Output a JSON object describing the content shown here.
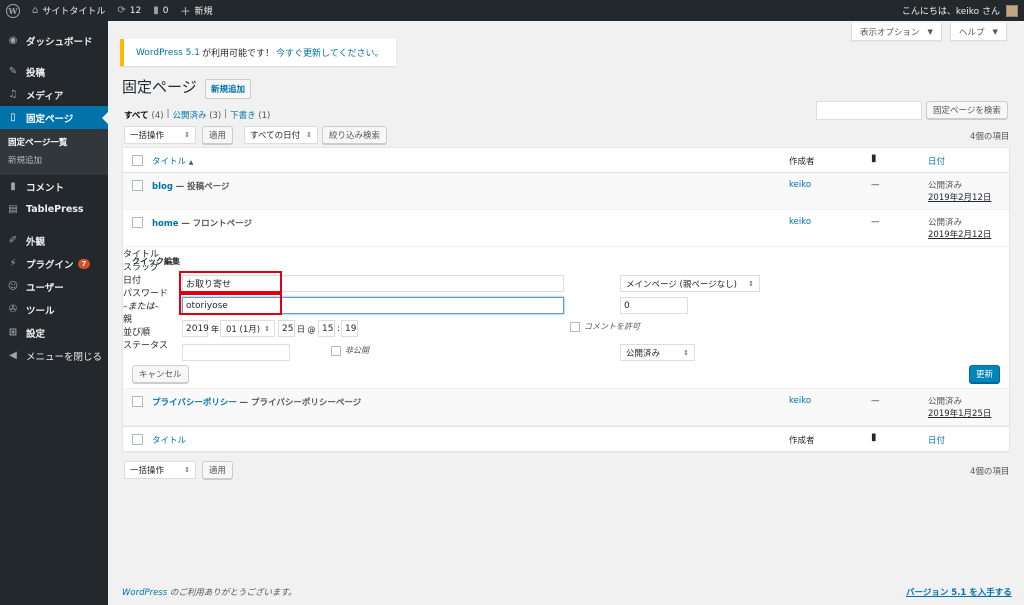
{
  "adminbar": {
    "wp_logo": "W",
    "site_title": "サイトタイトル",
    "updates_count": "12",
    "comments_count": "0",
    "new_label": "新規",
    "greeting": "こんにちは、keiko さん"
  },
  "sidebar": {
    "items": [
      {
        "icon": "dashboard-icon",
        "label": "ダッシュボード"
      },
      {
        "icon": "pin-icon",
        "label": "投稿"
      },
      {
        "icon": "media-icon",
        "label": "メディア"
      },
      {
        "icon": "page-icon",
        "label": "固定ページ"
      },
      {
        "icon": "comment-icon",
        "label": "コメント"
      },
      {
        "icon": "table-icon",
        "label": "TablePress"
      },
      {
        "icon": "appearance-icon",
        "label": "外観"
      },
      {
        "icon": "plugin-icon",
        "label": "プラグイン",
        "badge": "7"
      },
      {
        "icon": "user-icon",
        "label": "ユーザー"
      },
      {
        "icon": "tool-icon",
        "label": "ツール"
      },
      {
        "icon": "settings-icon",
        "label": "設定"
      },
      {
        "icon": "collapse-icon",
        "label": "メニューを閉じる"
      }
    ],
    "submenu": [
      "固定ページ一覧",
      "新規追加"
    ]
  },
  "screen_options": "表示オプション",
  "help": "ヘルプ",
  "notice": {
    "link1": "WordPress 5.1",
    "text": "が利用可能です！",
    "link2": "今すぐ更新してください。"
  },
  "page": {
    "title": "固定ページ",
    "add_new": "新規追加"
  },
  "filters": {
    "all": "すべて",
    "all_count": "(4)",
    "published": "公開済み",
    "published_count": "(3)",
    "draft": "下書き",
    "draft_count": "(1)",
    "sep": "|"
  },
  "search_button": "固定ページを検索",
  "bulk_action": "一括操作",
  "apply": "適用",
  "date_filter": "すべての日付",
  "filter_button": "絞り込み検索",
  "items_count": "4個の項目",
  "columns": {
    "title": "タイトル",
    "sort": "▲",
    "author": "作成者",
    "date": "日付"
  },
  "rows": [
    {
      "title": "blog",
      "type": "— 投稿ページ",
      "author": "keiko",
      "comments": "—",
      "status": "公開済み",
      "date": "2019年2月12日"
    },
    {
      "title": "home",
      "type": "— フロントページ",
      "author": "keiko",
      "comments": "—",
      "status": "公開済み",
      "date": "2019年2月12日"
    },
    {
      "title": "プライバシーポリシー",
      "type": "— プライバシーポリシーページ",
      "author": "keiko",
      "comments": "—",
      "status": "公開済み",
      "date": "2019年1月25日"
    }
  ],
  "quick_edit": {
    "heading": "クイック編集",
    "title_label": "タイトル",
    "title_value": "お取り寄せ",
    "slug_label": "スラッグ",
    "slug_value": "otoriyose",
    "date_label": "日付",
    "year": "2019",
    "year_suffix": "年",
    "month": "01 (1月)",
    "day": "25",
    "day_suffix": "日 @",
    "hour": "15",
    "colon": ":",
    "minute": "19",
    "password_label": "パスワード",
    "or_text": "–または–",
    "private_label": "非公開",
    "parent_label": "親",
    "parent_value": "メインページ (親ページなし)",
    "order_label": "並び順",
    "order_value": "0",
    "allow_comments": "コメントを許可",
    "status_label": "ステータス",
    "status_value": "公開済み",
    "cancel": "キャンセル",
    "update": "更新"
  },
  "footer": {
    "wp_link": "WordPress",
    "thanks": "のご利用ありがとうございます。",
    "version_link": "バージョン 5.1 を入手する"
  }
}
